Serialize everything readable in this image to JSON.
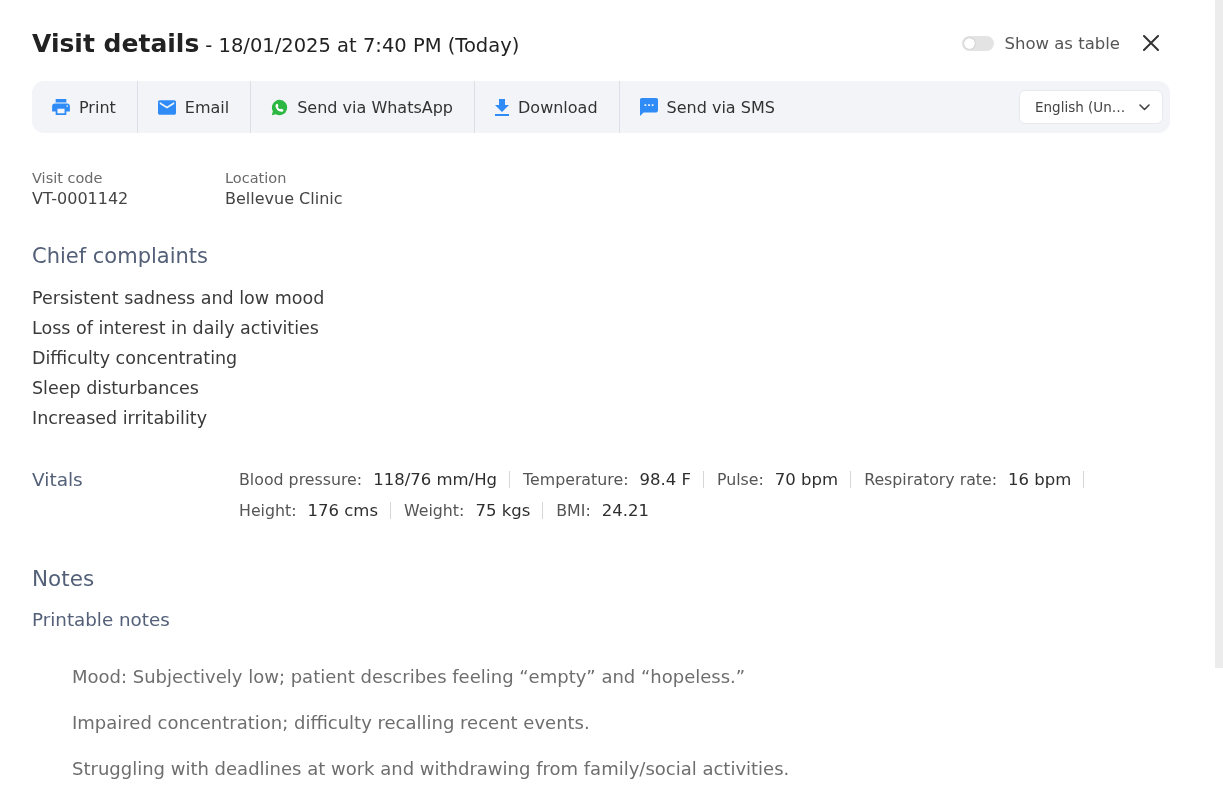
{
  "header": {
    "title": "Visit details",
    "subtitle": "- 18/01/2025 at 7:40 PM (Today)",
    "toggle": {
      "label": "Show as table",
      "on": false
    }
  },
  "toolbar": {
    "actions": [
      {
        "kind": "print",
        "label": "Print"
      },
      {
        "kind": "email",
        "label": "Email"
      },
      {
        "kind": "whatsapp",
        "label": "Send via WhatsApp"
      },
      {
        "kind": "download",
        "label": "Download"
      },
      {
        "kind": "sms",
        "label": "Send via SMS"
      }
    ],
    "language_select": {
      "value": "English (Un…"
    }
  },
  "visit_info": [
    {
      "label": "Visit code",
      "value": "VT-0001142"
    },
    {
      "label": "Location",
      "value": "Bellevue Clinic"
    }
  ],
  "chief_complaints": {
    "title": "Chief complaints",
    "items": [
      "Persistent sadness and low mood",
      "Loss of interest in daily activities",
      "Difficulty concentrating",
      "Sleep disturbances",
      "Increased irritability"
    ]
  },
  "vitals": {
    "title": "Vitals",
    "items": [
      {
        "label": "Blood pressure:",
        "value": "118/76 mm/Hg"
      },
      {
        "label": "Temperature:",
        "value": "98.4 F"
      },
      {
        "label": "Pulse:",
        "value": "70 bpm"
      },
      {
        "label": "Respiratory rate:",
        "value": "16 bpm"
      },
      {
        "label": "Height:",
        "value": "176 cms"
      },
      {
        "label": "Weight:",
        "value": "75 kgs"
      },
      {
        "label": "BMI:",
        "value": "24.21"
      }
    ]
  },
  "notes": {
    "title": "Notes",
    "subtitle": "Printable notes",
    "items": [
      "Mood: Subjectively low; patient describes feeling “empty” and “hopeless.”",
      "Impaired concentration; difficulty recalling recent events.",
      "Struggling with deadlines at work and withdrawing from family/social activities."
    ]
  }
}
